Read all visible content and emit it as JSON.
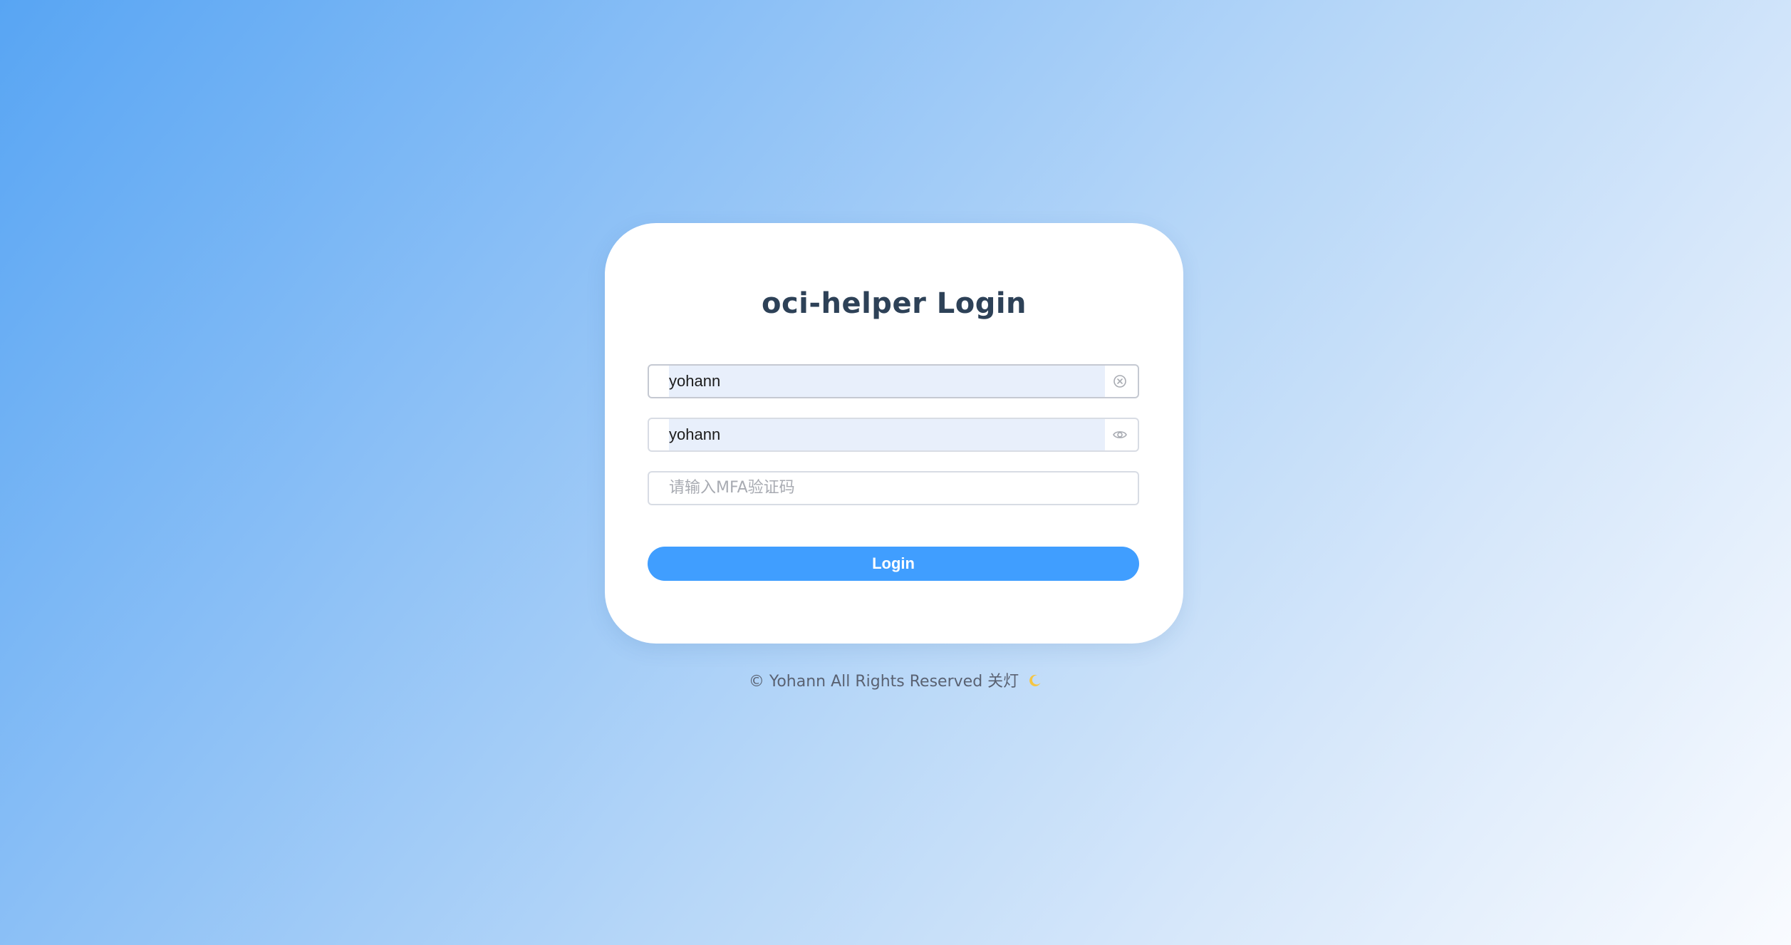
{
  "login": {
    "title": "oci-helper Login",
    "username_value": "yohann",
    "password_value": "yohann",
    "mfa_placeholder": "请输入MFA验证码",
    "submit_label": "Login"
  },
  "footer": {
    "copyright": "© Yohann All Rights Reserved",
    "theme_toggle": "关灯",
    "theme_icon": "moon-icon"
  },
  "colors": {
    "primary": "#409eff",
    "title": "#2d4157",
    "autofill_bg": "#e8effb",
    "gradient_start": "#58a5f3",
    "gradient_end": "#f9fbff"
  }
}
